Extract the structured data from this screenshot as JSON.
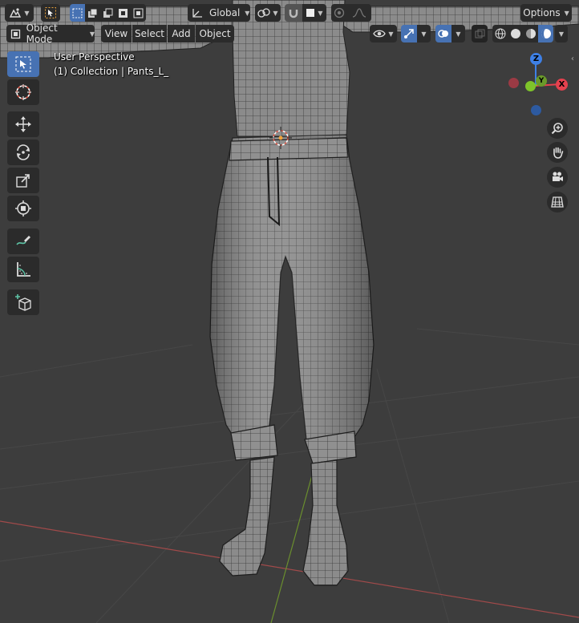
{
  "header": {
    "orientation": {
      "label": "Global"
    },
    "options": {
      "label": "Options"
    },
    "mode": {
      "label": "Object Mode"
    },
    "menus": [
      "View",
      "Select",
      "Add",
      "Object"
    ]
  },
  "overlay": {
    "view_name": "User Perspective",
    "collection": "(1) Collection | Pants_L_"
  },
  "gizmo": {
    "z_label": "Z",
    "y_label": "Y",
    "x_label": "X"
  },
  "colors": {
    "accent": "#4772b3",
    "viewport_bg": "#3d3d3d",
    "axis_x": "#e5414e",
    "axis_y": "#7ec42a",
    "axis_z": "#3e80e6",
    "grid_x_line": "#a14a4a",
    "grid_y_line": "#6a8e2e"
  },
  "icons": {
    "editor_type": "editor-type-icon",
    "select_tool": "select-arrow-icon",
    "snap": "magnet-icon",
    "proportional": "proportional-edit-icon",
    "zoom": "zoom-icon",
    "pan": "hand-icon",
    "camera": "camera-icon",
    "ortho": "grid-icon"
  }
}
